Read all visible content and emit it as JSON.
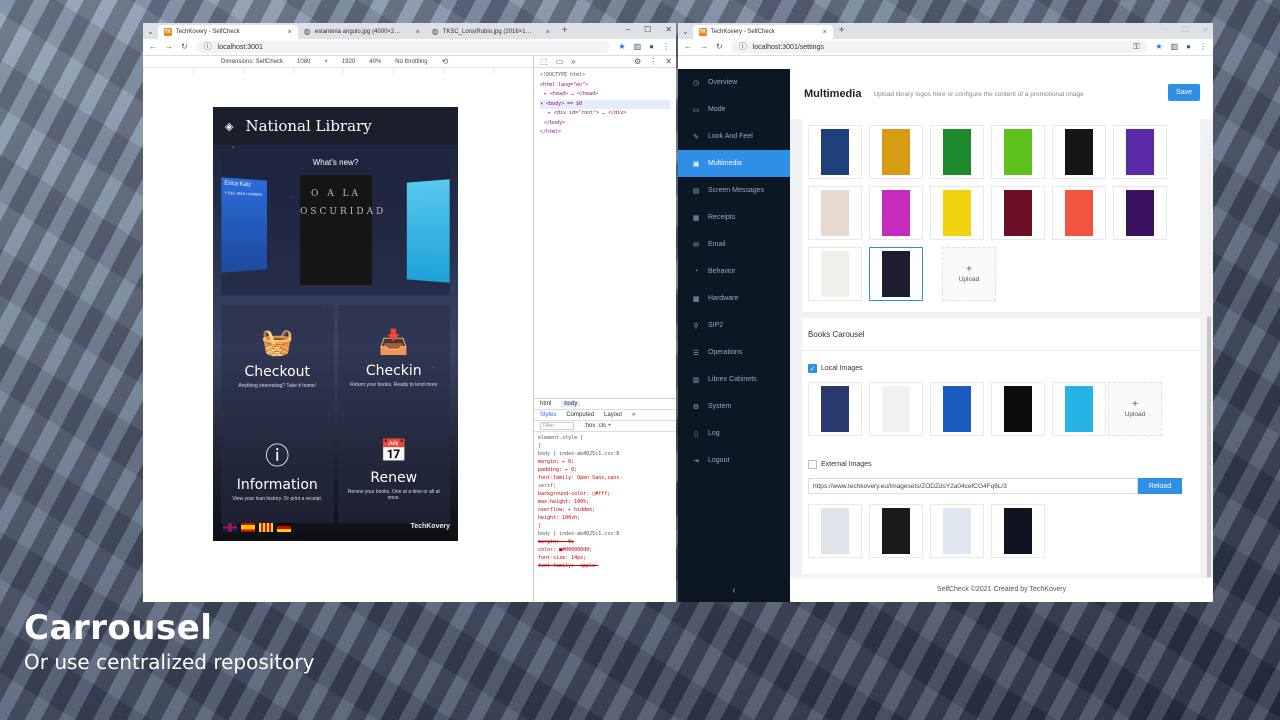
{
  "left_window": {
    "tabs": [
      {
        "label": "TechKovery - SelfCheck",
        "active": true
      },
      {
        "label": "estanteria angulo.jpg (4000×2…",
        "active": false
      },
      {
        "label": "TKSC_LonsiRubio.jpg (2016×1…",
        "active": false
      }
    ],
    "url": "localhost:3001",
    "device": {
      "label": "Dimensions: SelfCheck",
      "width": "1080",
      "x": "×",
      "height": "1920",
      "zoom": "40%",
      "throttle": "No throttling"
    },
    "app": {
      "title": "National Library",
      "whats_new": "What's new?",
      "carousel_books": [
        {
          "title": "Erica Katz",
          "subtitle": "Y DEL MÁS HOMBRE"
        },
        {
          "title": "O A LA OSCURIDAD",
          "subtitle": ""
        }
      ],
      "tiles": [
        {
          "name": "Checkout",
          "sub": "Anything interesting? Take it home!"
        },
        {
          "name": "Checkin",
          "sub": "Return your books. Ready to lend more"
        },
        {
          "name": "Information",
          "sub": "View your loan history. Or print a receipt."
        },
        {
          "name": "Renew",
          "sub": "Renew your books. One at a time or all at once."
        }
      ],
      "brand": "TechKovery"
    },
    "devtools": {
      "dom": [
        "<!DOCTYPE html>",
        "<html lang=\"en\">",
        "▸ <head> … </head>",
        "▾ <body> == $0",
        "▸ <div id=\"root\"> … </div>",
        "</body>",
        "</html>"
      ],
      "crumbs": [
        "html",
        "body"
      ],
      "panel_tabs": [
        "Styles",
        "Computed",
        "Layout",
        "»"
      ],
      "filter_placeholder": "Filter",
      "filter_tools": ":hov  .cls  +",
      "css": [
        "element.style {",
        "}",
        "body {          index-ab4025c1.css:8",
        "  margin: ▸ 0;",
        "  padding: ▸ 0;",
        "  font-family: Open Sans,sans-",
        "    serif;",
        "  background-color: □#fff;",
        "  max-height: 100%;",
        "  overflow: ▸ hidden;",
        "  height: 100vh;",
        "}",
        "body {          index-ab4025c1.css:8",
        "  margin: ▸ 0;",
        "  color: ■#000000d9;",
        "  font-size: 14px;",
        "  font-family: -apple-"
      ]
    }
  },
  "right_window": {
    "tab": "TechKovery - SelfCheck",
    "url": "localhost:3001/settings",
    "sidebar": [
      {
        "label": "Overview",
        "icon": "clock-icon"
      },
      {
        "label": "Mode",
        "icon": "screen-icon"
      },
      {
        "label": "Look And Feel",
        "icon": "brush-icon"
      },
      {
        "label": "Multimedia",
        "icon": "image-icon",
        "active": true
      },
      {
        "label": "Screen Messages",
        "icon": "message-icon"
      },
      {
        "label": "Receipts",
        "icon": "receipt-icon"
      },
      {
        "label": "Email",
        "icon": "mail-icon"
      },
      {
        "label": "Behavior",
        "icon": "gauge-icon"
      },
      {
        "label": "Hardware",
        "icon": "chip-icon"
      },
      {
        "label": "SIP2",
        "icon": "plug-icon"
      },
      {
        "label": "Operations",
        "icon": "list-icon"
      },
      {
        "label": "Librex Cabinets",
        "icon": "cabinet-icon"
      },
      {
        "label": "System",
        "icon": "gear-icon"
      },
      {
        "label": "Log",
        "icon": "log-icon"
      },
      {
        "label": "Logout",
        "icon": "logout-icon"
      }
    ],
    "header": {
      "title": "Multimedia",
      "description": "Upload library logos here or configure the content of a promotional image",
      "save": "Save"
    },
    "backgrounds": {
      "colors": [
        "#1e3f7a",
        "#d79b16",
        "#1c8a2c",
        "#5fc11d",
        "#151515",
        "#5b2aa6",
        "#e8d9d0",
        "#c62bb9",
        "#f0d20e",
        "#6d0f24",
        "#f35540",
        "#3b1262",
        "#eef0ec",
        "#1c1d2e"
      ],
      "upload": "Upload"
    },
    "books_carousel": {
      "title": "Books Carousel",
      "local_label": "Local Images",
      "local_colors": [
        "#2a3a6e",
        "#f2f2f2",
        "#1b5bbf",
        "#0d0d0d",
        "#27b3e6"
      ],
      "upload": "Upload",
      "external_label": "External Images",
      "external_url": "https://www.techkovery.eu/imagesets/ZODZdsY2a04cefCG4Fq6L/3",
      "reload": "Reload",
      "external_colors": [
        "#e0e4ea",
        "#1a1a1a",
        "#dfe6ef",
        "#0f1420"
      ]
    },
    "footer": "SelfCheck ©2021 Created by TechKovery"
  },
  "caption": {
    "title": "Carrousel",
    "subtitle": "Or use centralized repository"
  }
}
